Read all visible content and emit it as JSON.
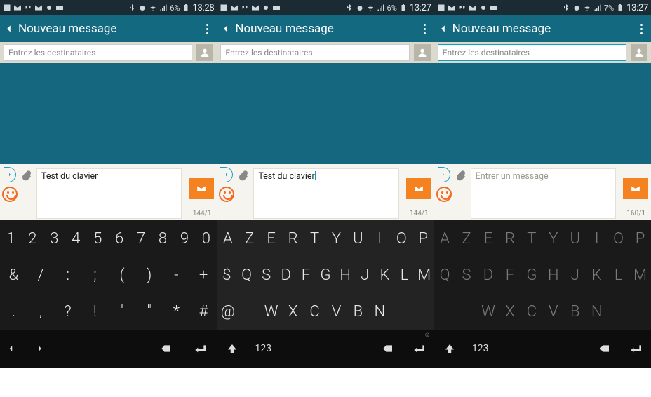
{
  "screens": [
    {
      "status": {
        "signal_pct": "6%",
        "time": "13:28"
      },
      "appbar": {
        "title": "Nouveau message"
      },
      "recipients": {
        "placeholder": "Entrez les destinataires",
        "focused": false
      },
      "compose": {
        "text_prefix": "Test du ",
        "text_underlined": "clavier",
        "placeholder": "",
        "counter": "144/1",
        "has_cursor": false,
        "is_placeholder": false
      }
    },
    {
      "status": {
        "signal_pct": "6%",
        "time": "13:27"
      },
      "appbar": {
        "title": "Nouveau message"
      },
      "recipients": {
        "placeholder": "Entrez les destinataires",
        "focused": false
      },
      "compose": {
        "text_prefix": "Test du ",
        "text_underlined": "clavier",
        "placeholder": "",
        "counter": "144/1",
        "has_cursor": true,
        "is_placeholder": false
      }
    },
    {
      "status": {
        "signal_pct": "7%",
        "time": "13:27"
      },
      "appbar": {
        "title": "Nouveau message"
      },
      "recipients": {
        "placeholder": "Entrez les destinataires",
        "focused": true
      },
      "compose": {
        "text_prefix": "",
        "text_underlined": "",
        "placeholder": "Entrer un message",
        "counter": "160/1",
        "has_cursor": false,
        "is_placeholder": true
      }
    }
  ],
  "keyboard": {
    "row1": {
      "A": [
        "1",
        "2",
        "3",
        "4",
        "5",
        "6",
        "7",
        "8",
        "9",
        "0"
      ],
      "B": [
        "A",
        "Z",
        "E",
        "R",
        "T",
        "Y",
        "U",
        "I",
        "O",
        "P"
      ],
      "C": [
        "A",
        "Z",
        "E",
        "R",
        "T",
        "Y",
        "U",
        "I",
        "O",
        "P"
      ]
    },
    "row2": {
      "A": [
        "&",
        "/",
        ":",
        ";",
        "(",
        ")",
        "-",
        "+"
      ],
      "B": [
        "$",
        "Q",
        "S",
        "D",
        "F",
        "G",
        "H",
        "J",
        "K",
        "L",
        "M"
      ],
      "C": [
        "Q",
        "S",
        "D",
        "F",
        "G",
        "H",
        "J",
        "K",
        "L",
        "M"
      ]
    },
    "row3": {
      "A": [
        ".",
        ",",
        "?",
        "!",
        "'",
        "\"",
        "*",
        "#"
      ],
      "B": [
        "@",
        "",
        "W",
        "X",
        "C",
        "V",
        "B",
        "N",
        "",
        ""
      ],
      "C": [
        "",
        "",
        "W",
        "X",
        "C",
        "V",
        "B",
        "N",
        "",
        ""
      ]
    },
    "bottom": {
      "label_123": "123"
    }
  }
}
